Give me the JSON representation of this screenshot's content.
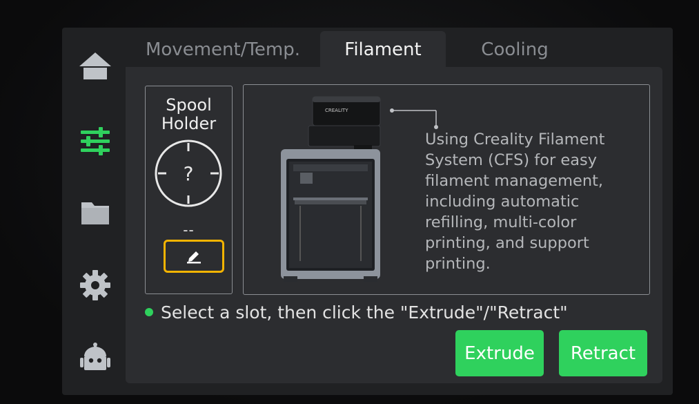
{
  "sidebar": {
    "items": [
      {
        "icon": "home-icon",
        "active": false
      },
      {
        "icon": "sliders-icon",
        "active": true
      },
      {
        "icon": "folder-icon",
        "active": false
      },
      {
        "icon": "gear-icon",
        "active": false
      },
      {
        "icon": "robot-icon",
        "active": false
      }
    ]
  },
  "tabs": [
    {
      "label": "Movement/Temp.",
      "active": false
    },
    {
      "label": "Filament",
      "active": true
    },
    {
      "label": "Cooling",
      "active": false
    }
  ],
  "spool": {
    "title": "Spool\nHolder",
    "dial_symbol": "?",
    "value": "--",
    "edit_icon": "pencil-icon"
  },
  "info": {
    "printer_brand": "CREALITY",
    "text": "Using Creality Filament System (CFS) for easy filament management, including automatic refilling, multi-color printing, and support printing."
  },
  "hint": "Select a slot, then click the \"Extrude\"/\"Retract\"",
  "buttons": {
    "extrude": "Extrude",
    "retract": "Retract"
  },
  "colors": {
    "accent_green": "#2fd15d",
    "highlight_yellow": "#f5b400"
  }
}
